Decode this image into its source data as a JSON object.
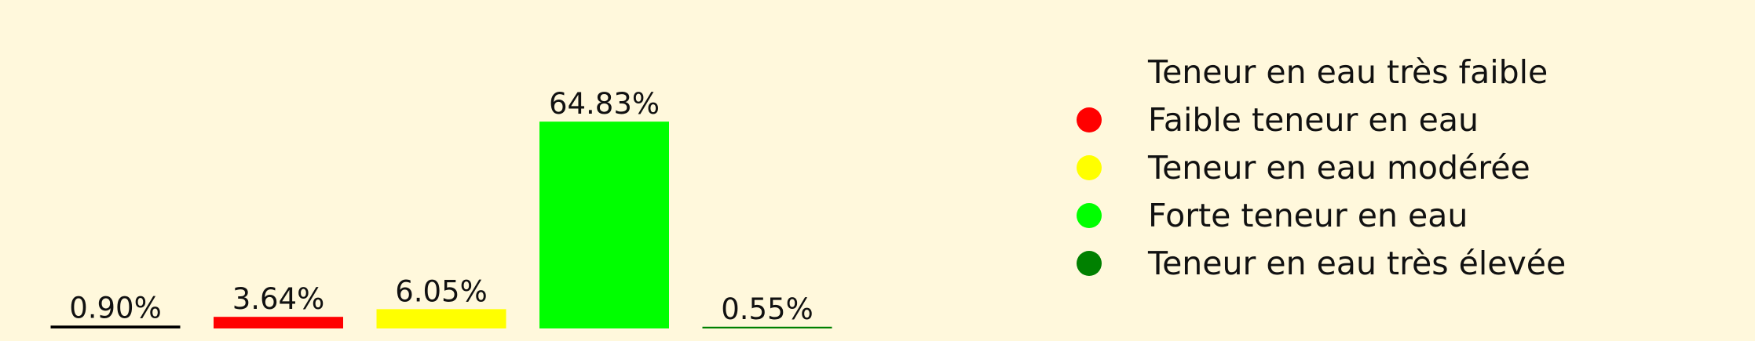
{
  "chart_data": {
    "type": "bar",
    "categories": [
      "Teneur en eau très faible",
      "Faible teneur en eau",
      "Teneur en eau modérée",
      "Forte teneur en eau",
      "Teneur en eau très élevée"
    ],
    "values": [
      0.9,
      3.64,
      6.05,
      64.83,
      0.55
    ],
    "value_labels": [
      "0.90%",
      "3.64%",
      "6.05%",
      "64.83%",
      "0.55%"
    ],
    "unit": "%",
    "colors": [
      "#000000",
      "#ff0000",
      "#ffff00",
      "#00ff00",
      "#008000"
    ],
    "ylim": [
      0,
      70
    ],
    "grid": false,
    "axes_visible": false,
    "legend": {
      "position": "right",
      "entries": [
        {
          "label": "Teneur en eau très faible",
          "color": "#000000",
          "marker_visible": false
        },
        {
          "label": "Faible teneur en eau",
          "color": "#ff0000",
          "marker_visible": true
        },
        {
          "label": "Teneur en eau modérée",
          "color": "#ffff00",
          "marker_visible": true
        },
        {
          "label": "Forte teneur en eau",
          "color": "#00ff00",
          "marker_visible": true
        },
        {
          "label": "Teneur en eau très élevée",
          "color": "#008000",
          "marker_visible": true
        }
      ]
    },
    "background": "#fff8dc"
  }
}
